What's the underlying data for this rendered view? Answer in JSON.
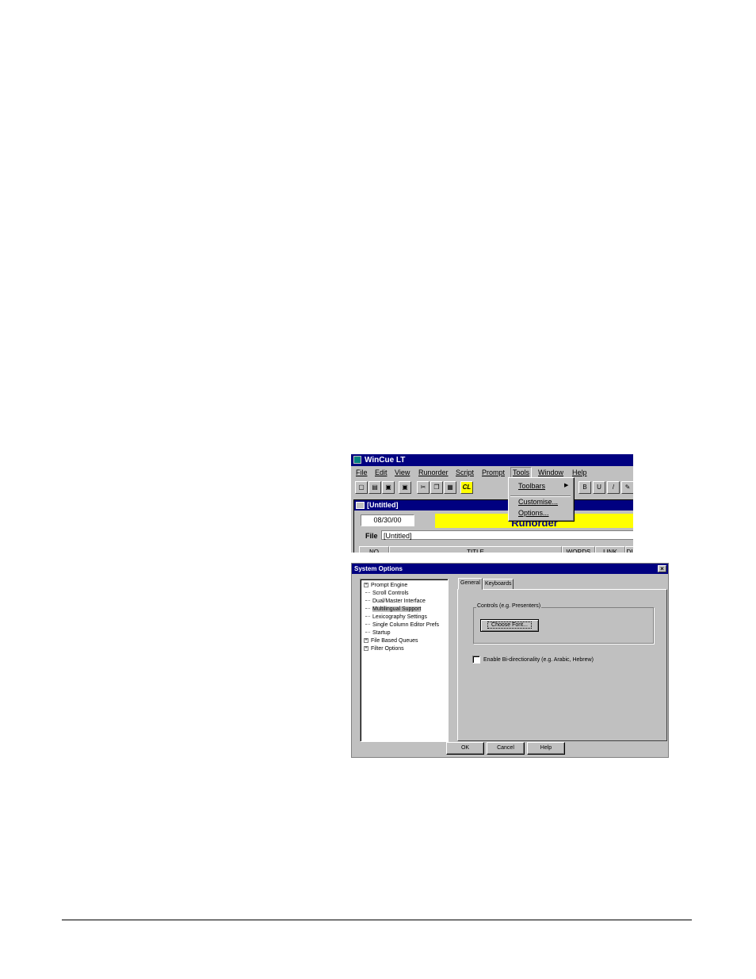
{
  "wincue": {
    "title": "WinCue LT",
    "menu": [
      "File",
      "Edit",
      "View",
      "Runorder",
      "Script",
      "Prompt",
      "Tools",
      "Window",
      "Help"
    ],
    "tools_menu": {
      "toolbars": "Toolbars",
      "customise": "Customise...",
      "options": "Options..."
    },
    "toolbar": {
      "cl_label": "CL"
    },
    "document": {
      "title": "[Untitled]",
      "date": "08/30/00",
      "banner": "Runorder",
      "file_label": "File",
      "file_value": "[Untitled]",
      "columns": [
        "NO",
        "TITLE",
        "WORDS",
        "LINK",
        "DI"
      ]
    }
  },
  "system_options": {
    "title": "System Options",
    "close": "×",
    "tree": [
      {
        "label": "Prompt Engine",
        "expandable": true
      },
      {
        "label": "Scroll Controls",
        "expandable": false
      },
      {
        "label": "Dual/Master Interface",
        "expandable": false
      },
      {
        "label": "Multilingual Support",
        "expandable": false,
        "selected": true
      },
      {
        "label": "Lexicography Settings",
        "expandable": false
      },
      {
        "label": "Single Column Editor Prefs",
        "expandable": false
      },
      {
        "label": "Startup",
        "expandable": false
      },
      {
        "label": "File Based Queues",
        "expandable": true
      },
      {
        "label": "Filter Options",
        "expandable": true
      }
    ],
    "tabs": [
      "General",
      "Keyboards"
    ],
    "group_label": "Controls (e.g. Presenters)",
    "choose_font": "Choose Font...",
    "bidi_checkbox": "Enable Bi-directionality (e.g. Arabic, Hebrew)",
    "buttons": {
      "ok": "OK",
      "cancel": "Cancel",
      "help": "Help"
    }
  }
}
